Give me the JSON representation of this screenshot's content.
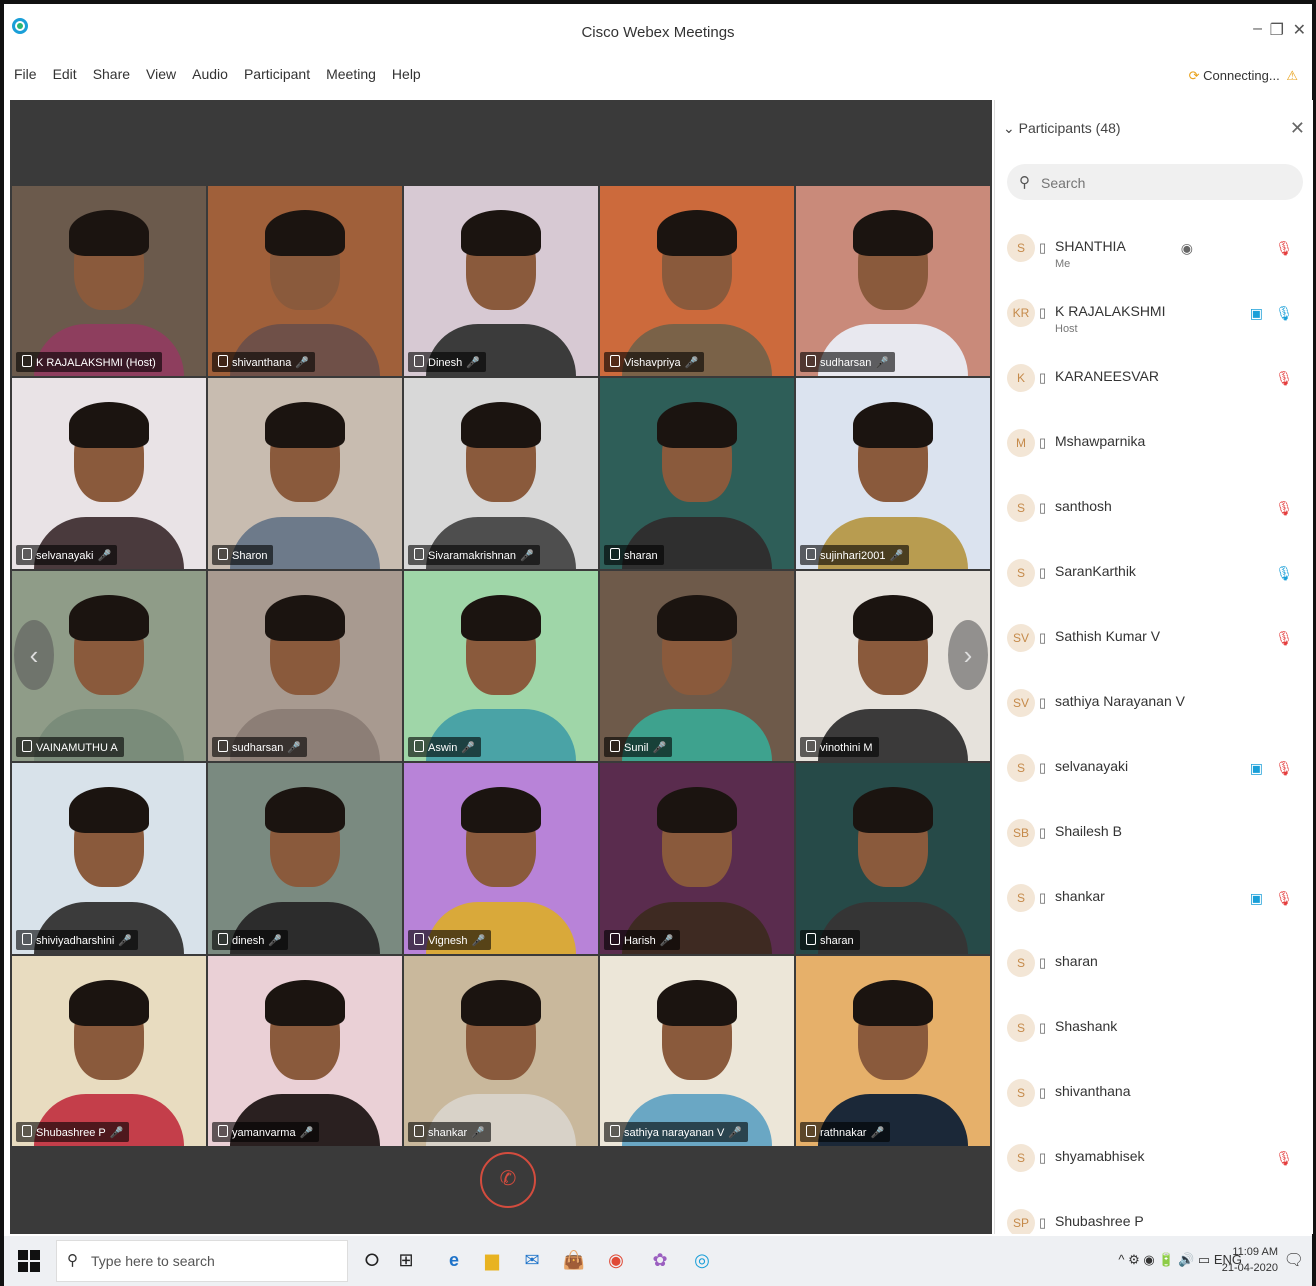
{
  "window": {
    "title": "Cisco Webex Meetings",
    "minimize": "–",
    "restore": "❐",
    "close": "✕"
  },
  "menu": [
    "File",
    "Edit",
    "Share",
    "View",
    "Audio",
    "Participant",
    "Meeting",
    "Help"
  ],
  "status": {
    "connecting": "Connecting..."
  },
  "video_grid": {
    "tiles": [
      {
        "name": "K RAJALAKSHMI (Host)",
        "muted": false,
        "bg": "#6b5a4c",
        "shirt": "#8e3e5e"
      },
      {
        "name": "shivanthana",
        "muted": true,
        "bg": "#a0603a",
        "shirt": "#6f5048"
      },
      {
        "name": "Dinesh",
        "muted": true,
        "bg": "#d7c9d3",
        "shirt": "#3b3b3b"
      },
      {
        "name": "Vishavpriya",
        "muted": true,
        "bg": "#cc6a3c",
        "shirt": "#7a6248"
      },
      {
        "name": "sudharsan",
        "muted": true,
        "bg": "#c98a7a",
        "shirt": "#e8e8ef"
      },
      {
        "name": "selvanayaki",
        "muted": true,
        "bg": "#e9e3e6",
        "shirt": "#4a3a3d"
      },
      {
        "name": "Sharon",
        "muted": false,
        "bg": "#c8bcb0",
        "shirt": "#6d7a8a"
      },
      {
        "name": "Sivaramakrishnan",
        "muted": true,
        "bg": "#d8d8d8",
        "shirt": "#4e4e4e"
      },
      {
        "name": "sharan",
        "muted": false,
        "bg": "#2e5e58",
        "shirt": "#2f2f2f"
      },
      {
        "name": "sujinhari2001",
        "muted": true,
        "bg": "#dbe3ef",
        "shirt": "#b89c50"
      },
      {
        "name": "VAINAMUTHU A",
        "muted": false,
        "bg": "#8f9c88",
        "shirt": "#7a8c7a"
      },
      {
        "name": "sudharsan",
        "muted": true,
        "bg": "#a89a90",
        "shirt": "#8c7e76"
      },
      {
        "name": "Aswin",
        "muted": true,
        "bg": "#9fd6a8",
        "shirt": "#4aa3a6"
      },
      {
        "name": "Sunil",
        "muted": true,
        "bg": "#6e5a4a",
        "shirt": "#3ea28e"
      },
      {
        "name": "vinothini M",
        "muted": false,
        "bg": "#e6e2dc",
        "shirt": "#3b3a3a"
      },
      {
        "name": "shiviyadharshini",
        "muted": true,
        "bg": "#d8e2ea",
        "shirt": "#3b3b3b"
      },
      {
        "name": "dinesh",
        "muted": true,
        "bg": "#7a8a80",
        "shirt": "#2c2c2c"
      },
      {
        "name": "Vignesh",
        "muted": true,
        "bg": "#b883d8",
        "shirt": "#d9a93a"
      },
      {
        "name": "Harish",
        "muted": true,
        "bg": "#5a2c4e",
        "shirt": "#3e2a22"
      },
      {
        "name": "sharan",
        "muted": false,
        "bg": "#264a48",
        "shirt": "#353535"
      },
      {
        "name": "Shubashree P",
        "muted": true,
        "bg": "#e8dcc0",
        "shirt": "#c43e4a"
      },
      {
        "name": "yamanvarma",
        "muted": true,
        "bg": "#ead0d6",
        "shirt": "#2a2020"
      },
      {
        "name": "shankar",
        "muted": true,
        "bg": "#c9b89c",
        "shirt": "#d8d2c8"
      },
      {
        "name": "sathiya narayanan V",
        "muted": true,
        "bg": "#ece6d8",
        "shirt": "#6aa7c4"
      },
      {
        "name": "rathnakar",
        "muted": true,
        "bg": "#e6b06a",
        "shirt": "#1b2838"
      }
    ]
  },
  "nav": {
    "prev": "‹",
    "next": "›"
  },
  "end_button": "✆",
  "participants": {
    "header": "Participants (48)",
    "close": "✕",
    "search_placeholder": "Search",
    "list": [
      {
        "initials": "S",
        "name": "SHANTHIA",
        "role": "Me",
        "video": false,
        "host_icon": true,
        "mic": "muted"
      },
      {
        "initials": "KR",
        "name": "K RAJALAKSHMI",
        "role": "Host",
        "video": true,
        "host_icon": false,
        "mic": "on"
      },
      {
        "initials": "K",
        "name": "KARANEESVAR",
        "role": "",
        "video": false,
        "host_icon": false,
        "mic": "muted"
      },
      {
        "initials": "M",
        "name": "Mshawparnika",
        "role": "",
        "video": false,
        "host_icon": false,
        "mic": ""
      },
      {
        "initials": "S",
        "name": "santhosh",
        "role": "",
        "video": false,
        "host_icon": false,
        "mic": "muted"
      },
      {
        "initials": "S",
        "name": "SaranKarthik",
        "role": "",
        "video": false,
        "host_icon": false,
        "mic": "on"
      },
      {
        "initials": "SV",
        "name": "Sathish Kumar V",
        "role": "",
        "video": false,
        "host_icon": false,
        "mic": "muted"
      },
      {
        "initials": "SV",
        "name": "sathiya Narayanan V",
        "role": "",
        "video": false,
        "host_icon": false,
        "mic": ""
      },
      {
        "initials": "S",
        "name": "selvanayaki",
        "role": "",
        "video": true,
        "host_icon": false,
        "mic": "muted"
      },
      {
        "initials": "SB",
        "name": "Shailesh B",
        "role": "",
        "video": false,
        "host_icon": false,
        "mic": ""
      },
      {
        "initials": "S",
        "name": "shankar",
        "role": "",
        "video": true,
        "host_icon": false,
        "mic": "muted"
      },
      {
        "initials": "S",
        "name": "sharan",
        "role": "",
        "video": false,
        "host_icon": false,
        "mic": ""
      },
      {
        "initials": "S",
        "name": "Shashank",
        "role": "",
        "video": false,
        "host_icon": false,
        "mic": ""
      },
      {
        "initials": "S",
        "name": "shivanthana",
        "role": "",
        "video": false,
        "host_icon": false,
        "mic": ""
      },
      {
        "initials": "S",
        "name": "shyamabhisek",
        "role": "",
        "video": false,
        "host_icon": false,
        "mic": "muted"
      },
      {
        "initials": "SP",
        "name": "Shubashree P",
        "role": "",
        "video": false,
        "host_icon": false,
        "mic": ""
      }
    ]
  },
  "taskbar": {
    "search_placeholder": "Type here to search",
    "apps": [
      "⭘",
      "⊞",
      "e",
      "▆",
      "✉",
      "👜",
      "◉",
      "✿",
      "◎"
    ],
    "tray": "^ ⚙ ◉ 🔋 🔊 ▭ ENG",
    "time": "11:09 AM",
    "date": "21-04-2020",
    "notification_icon": "🗨"
  }
}
